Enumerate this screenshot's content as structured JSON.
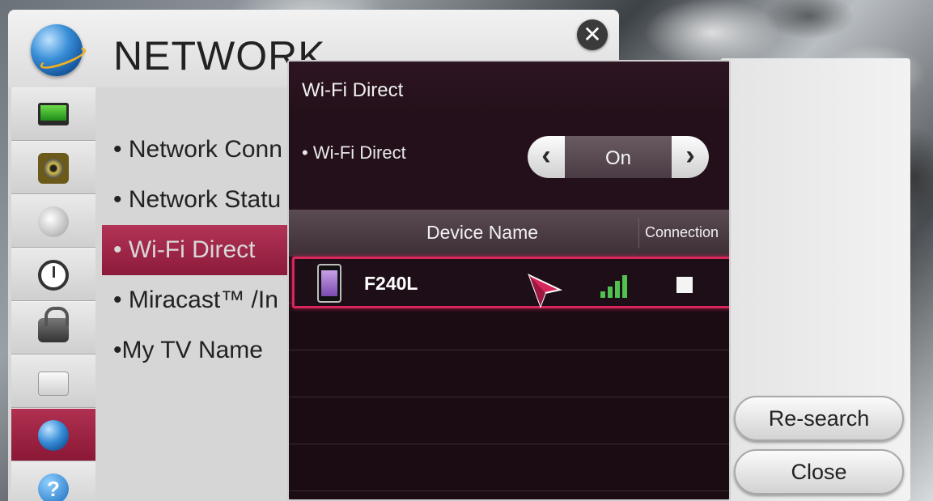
{
  "network": {
    "title": "NETWORK",
    "close_icon": "close-x-icon",
    "sidebar": [
      {
        "name": "sidebar-item-picture",
        "icon": "tv-icon"
      },
      {
        "name": "sidebar-item-sound",
        "icon": "speaker-icon"
      },
      {
        "name": "sidebar-item-channel",
        "icon": "satellite-dish-icon"
      },
      {
        "name": "sidebar-item-time",
        "icon": "clock-icon"
      },
      {
        "name": "sidebar-item-lock",
        "icon": "lock-icon"
      },
      {
        "name": "sidebar-item-option",
        "icon": "briefcase-icon"
      },
      {
        "name": "sidebar-item-network",
        "icon": "globe-icon",
        "active": true
      },
      {
        "name": "sidebar-item-support",
        "icon": "help-icon"
      }
    ],
    "menu": [
      {
        "label": "• Network Conn"
      },
      {
        "label": "• Network Statu"
      },
      {
        "label": "• Wi-Fi Direct",
        "selected": true
      },
      {
        "label": "• Miracast™ /In"
      },
      {
        "label": "•My TV Name"
      }
    ]
  },
  "wifi_direct": {
    "title": "Wi-Fi Direct",
    "option_label": "• Wi-Fi Direct",
    "option_value": "On",
    "columns": {
      "device": "Device Name",
      "connection": "Connection"
    },
    "devices": [
      {
        "name": "F240L",
        "signal_bars": 4,
        "connected": false
      }
    ]
  },
  "buttons": {
    "research": "Re-search",
    "close": "Close"
  },
  "colors": {
    "accent": "#d7265a",
    "selected_menu": "#9c2446",
    "dialog_bg": "#1b0c14",
    "signal": "#4fc24f"
  }
}
